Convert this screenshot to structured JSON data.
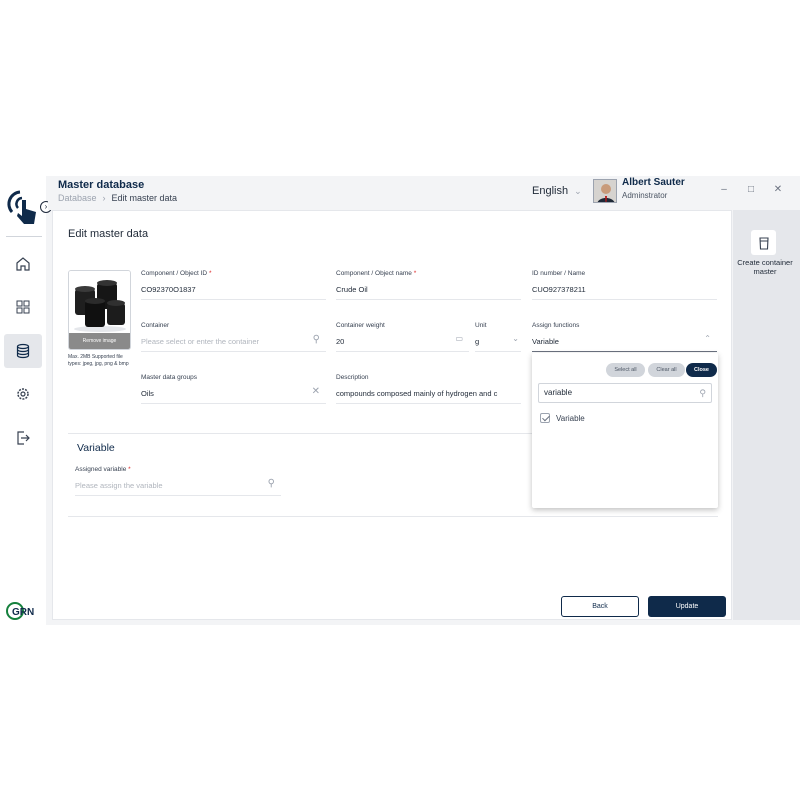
{
  "header": {
    "title": "Master database",
    "breadcrumb": [
      "Database",
      "Edit master data"
    ],
    "language": "English",
    "user": {
      "name": "Albert Sauter",
      "role": "Adminstrator"
    }
  },
  "sidebar": {
    "items": [
      {
        "icon": "home-icon"
      },
      {
        "icon": "dashboard-icon"
      },
      {
        "icon": "database-icon",
        "active": true
      },
      {
        "icon": "settings-icon"
      },
      {
        "icon": "logout-icon"
      }
    ],
    "brand": "GRN"
  },
  "main": {
    "title": "Edit master data",
    "image": {
      "remove_label": "Remove image",
      "note": "Max. 2MB Supported file types: jpeg, jpg, png & bmp"
    },
    "fields": {
      "component_id": {
        "label": "Component / Object ID",
        "value": "CO92370O1837"
      },
      "component_name": {
        "label": "Component / Object name",
        "value": "Crude Oil"
      },
      "id_number": {
        "label": "ID number / Name",
        "value": "CUO927378211"
      },
      "container": {
        "label": "Container",
        "placeholder": "Please select or enter the container"
      },
      "container_weight": {
        "label": "Container weight",
        "value": "20"
      },
      "unit": {
        "label": "Unit",
        "value": "g"
      },
      "assign_functions": {
        "label": "Assign functions",
        "value": "Variable"
      },
      "master_groups": {
        "label": "Master data groups",
        "value": "Oils"
      },
      "description": {
        "label": "Description",
        "value": "compounds composed mainly of hydrogen and c"
      }
    },
    "variable_section": {
      "title": "Variable",
      "assigned_variable": {
        "label": "Assigned variable",
        "placeholder": "Please assign the variable"
      }
    },
    "buttons": {
      "back": "Back",
      "update": "Update"
    }
  },
  "dropdown": {
    "select_all": "Select all",
    "clear_all": "Clear all",
    "close": "Close",
    "search_value": "variable",
    "options": [
      {
        "label": "Variable",
        "checked": true
      }
    ]
  },
  "right_panel": {
    "action_label": "Create container master"
  },
  "colors": {
    "primary": "#0f2a4a",
    "required": "#dc2626",
    "background": "#f3f4f6"
  }
}
